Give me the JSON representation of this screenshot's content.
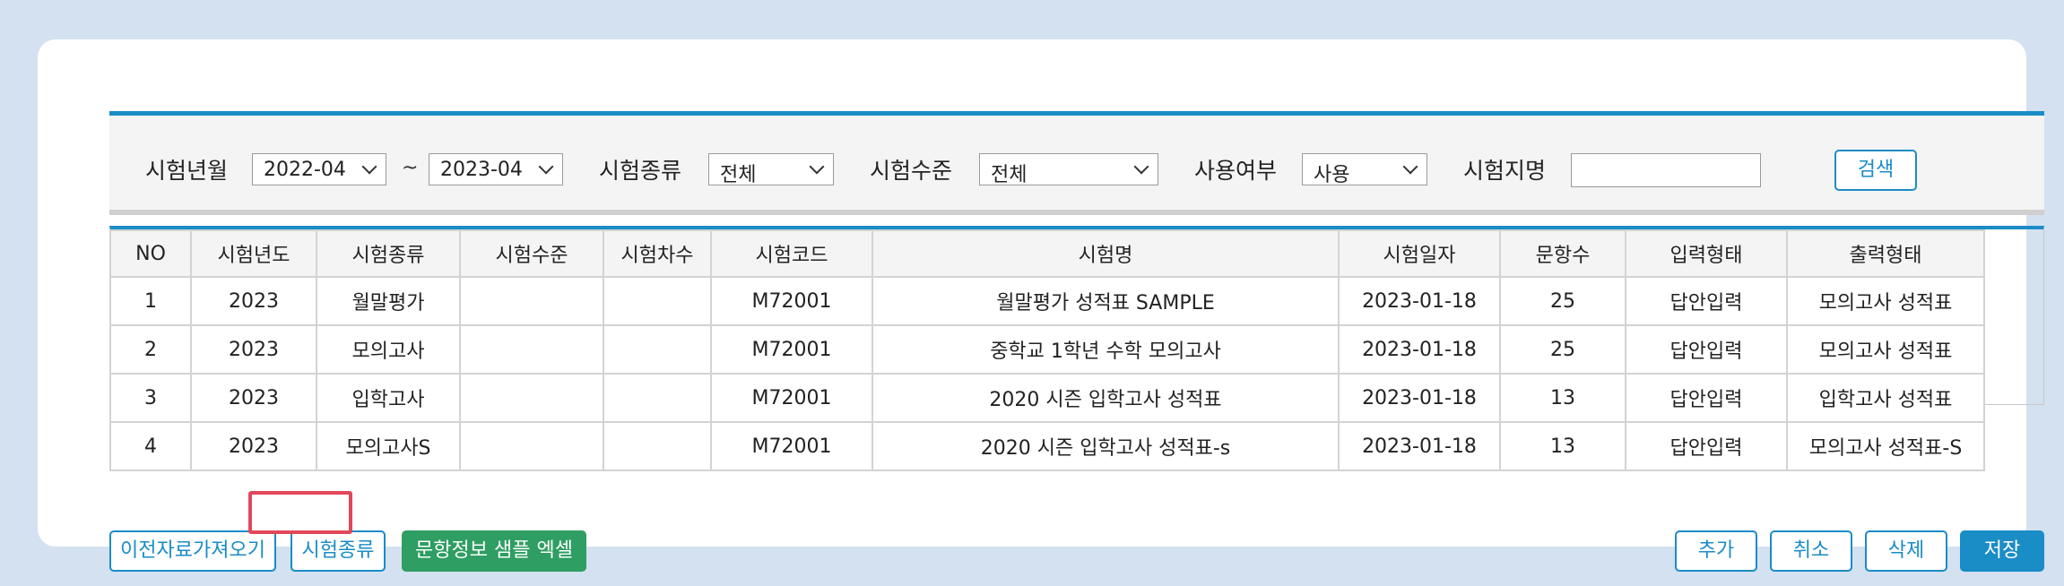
{
  "search": {
    "period_label": "시험년월",
    "period_from": "2022-04",
    "period_sep": "~",
    "period_to": "2023-04",
    "type_label": "시험종류",
    "type_value": "전체",
    "level_label": "시험수준",
    "level_value": "전체",
    "usage_label": "사용여부",
    "usage_value": "사용",
    "name_label": "시험지명",
    "name_value": "",
    "search_button": "검색"
  },
  "table": {
    "headers": [
      "NO",
      "시험년도",
      "시험종류",
      "시험수준",
      "시험차수",
      "시험코드",
      "시험명",
      "시험일자",
      "문항수",
      "입력형태",
      "출력형태"
    ],
    "rows": [
      [
        "1",
        "2023",
        "월말평가",
        "",
        "",
        "M72001",
        "월말평가 성적표 SAMPLE",
        "2023-01-18",
        "25",
        "답안입력",
        "모의고사 성적표"
      ],
      [
        "2",
        "2023",
        "모의고사",
        "",
        "",
        "M72001",
        "중학교 1학년 수학 모의고사",
        "2023-01-18",
        "25",
        "답안입력",
        "모의고사 성적표"
      ],
      [
        "3",
        "2023",
        "입학고사",
        "",
        "",
        "M72001",
        "2020 시즌 입학고사 성적표",
        "2023-01-18",
        "13",
        "답안입력",
        "입학고사 성적표"
      ],
      [
        "4",
        "2023",
        "모의고사S",
        "",
        "",
        "M72001",
        "2020 시즌 입학고사 성적표-s",
        "2023-01-18",
        "13",
        "답안입력",
        "모의고사 성적표-S"
      ]
    ]
  },
  "actions": {
    "import_prev": "이전자료가져오기",
    "exam_type": "시험종류",
    "sample_excel": "문항정보 샘플 엑셀",
    "add": "추가",
    "cancel": "취소",
    "delete": "삭제",
    "save": "저장"
  },
  "colors": {
    "accent": "#1a8cc6",
    "green": "#2e9e62",
    "highlight": "#e2485a",
    "background": "#d3e1f1"
  }
}
